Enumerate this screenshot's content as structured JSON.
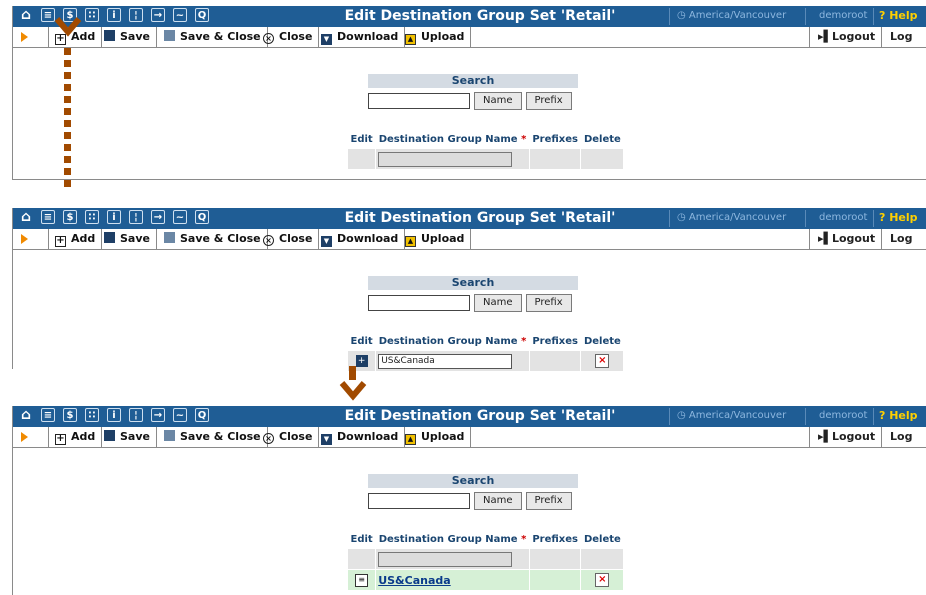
{
  "app": {
    "title": "Edit Destination Group Set 'Retail'",
    "timezone": "America/Vancouver",
    "user": "demoroot",
    "help": "Help",
    "nav_icons": [
      "home-icon",
      "list-icon",
      "dollar-icon",
      "grid-icon",
      "person-icon",
      "tree-icon",
      "export-icon",
      "chart-icon",
      "search-icon"
    ]
  },
  "toolbar": {
    "add": "Add",
    "save": "Save",
    "save_close": "Save & Close",
    "close": "Close",
    "download": "Download",
    "upload": "Upload",
    "logout": "Logout",
    "log": "Log"
  },
  "search": {
    "title": "Search",
    "name_button": "Name",
    "prefix_button": "Prefix"
  },
  "table": {
    "headers": [
      "Edit",
      "Destination Group Name",
      "Prefixes",
      "Delete"
    ],
    "required_mark": "*"
  },
  "step2": {
    "new_row_value": "US&Canada"
  },
  "step3": {
    "saved_row_name": "US&Canada"
  },
  "colors": {
    "topbar": "#1f5d95",
    "arrow": "#a14a00",
    "saved_row": "#d6f0d6"
  }
}
